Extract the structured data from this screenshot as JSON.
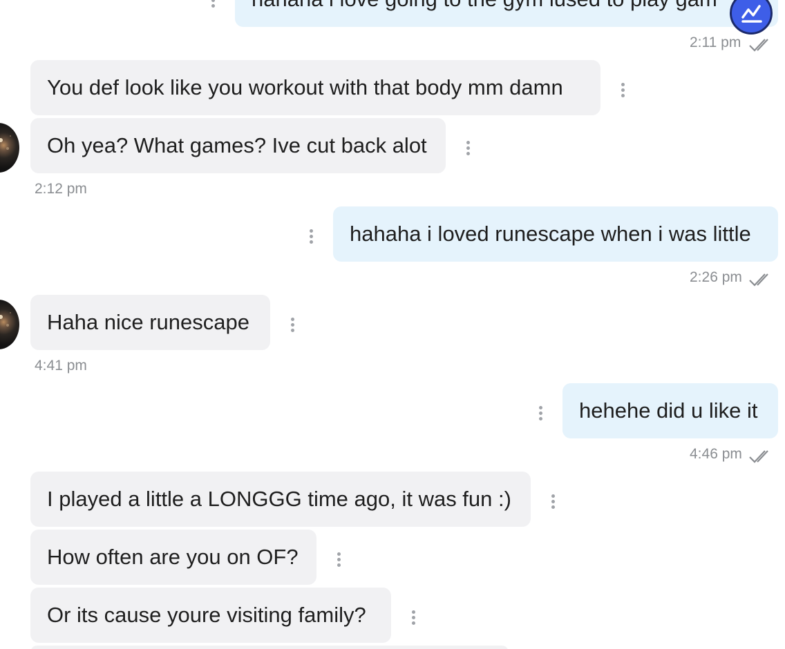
{
  "messages": [
    {
      "text": "hahaha i love going to the gym iused to play gam",
      "time": "2:11 pm"
    },
    {
      "text": "You def look like you workout with that body mm damn"
    },
    {
      "text": "Oh yea? What games? Ive cut back alot",
      "time": "2:12 pm"
    },
    {
      "text": "hahaha i loved runescape when i was little",
      "time": "2:26 pm"
    },
    {
      "text": "Haha nice runescape",
      "time": "4:41 pm"
    },
    {
      "text": "hehehe did u like it",
      "time": "4:46 pm"
    },
    {
      "text": "I played a little a LONGGG time ago, it was fun :)"
    },
    {
      "text": "How often are you on OF?"
    },
    {
      "text": "Or its cause youre visiting family?"
    }
  ],
  "icons": {
    "options": "more-vertical-icon",
    "read_receipt": "double-check-icon",
    "fab": "stats-line-icon"
  },
  "colors": {
    "incoming_bubble": "#f1f1f3",
    "outgoing_bubble": "#e5f3fc",
    "timestamp": "#8a8d91",
    "fab": "#3e5ee8"
  }
}
